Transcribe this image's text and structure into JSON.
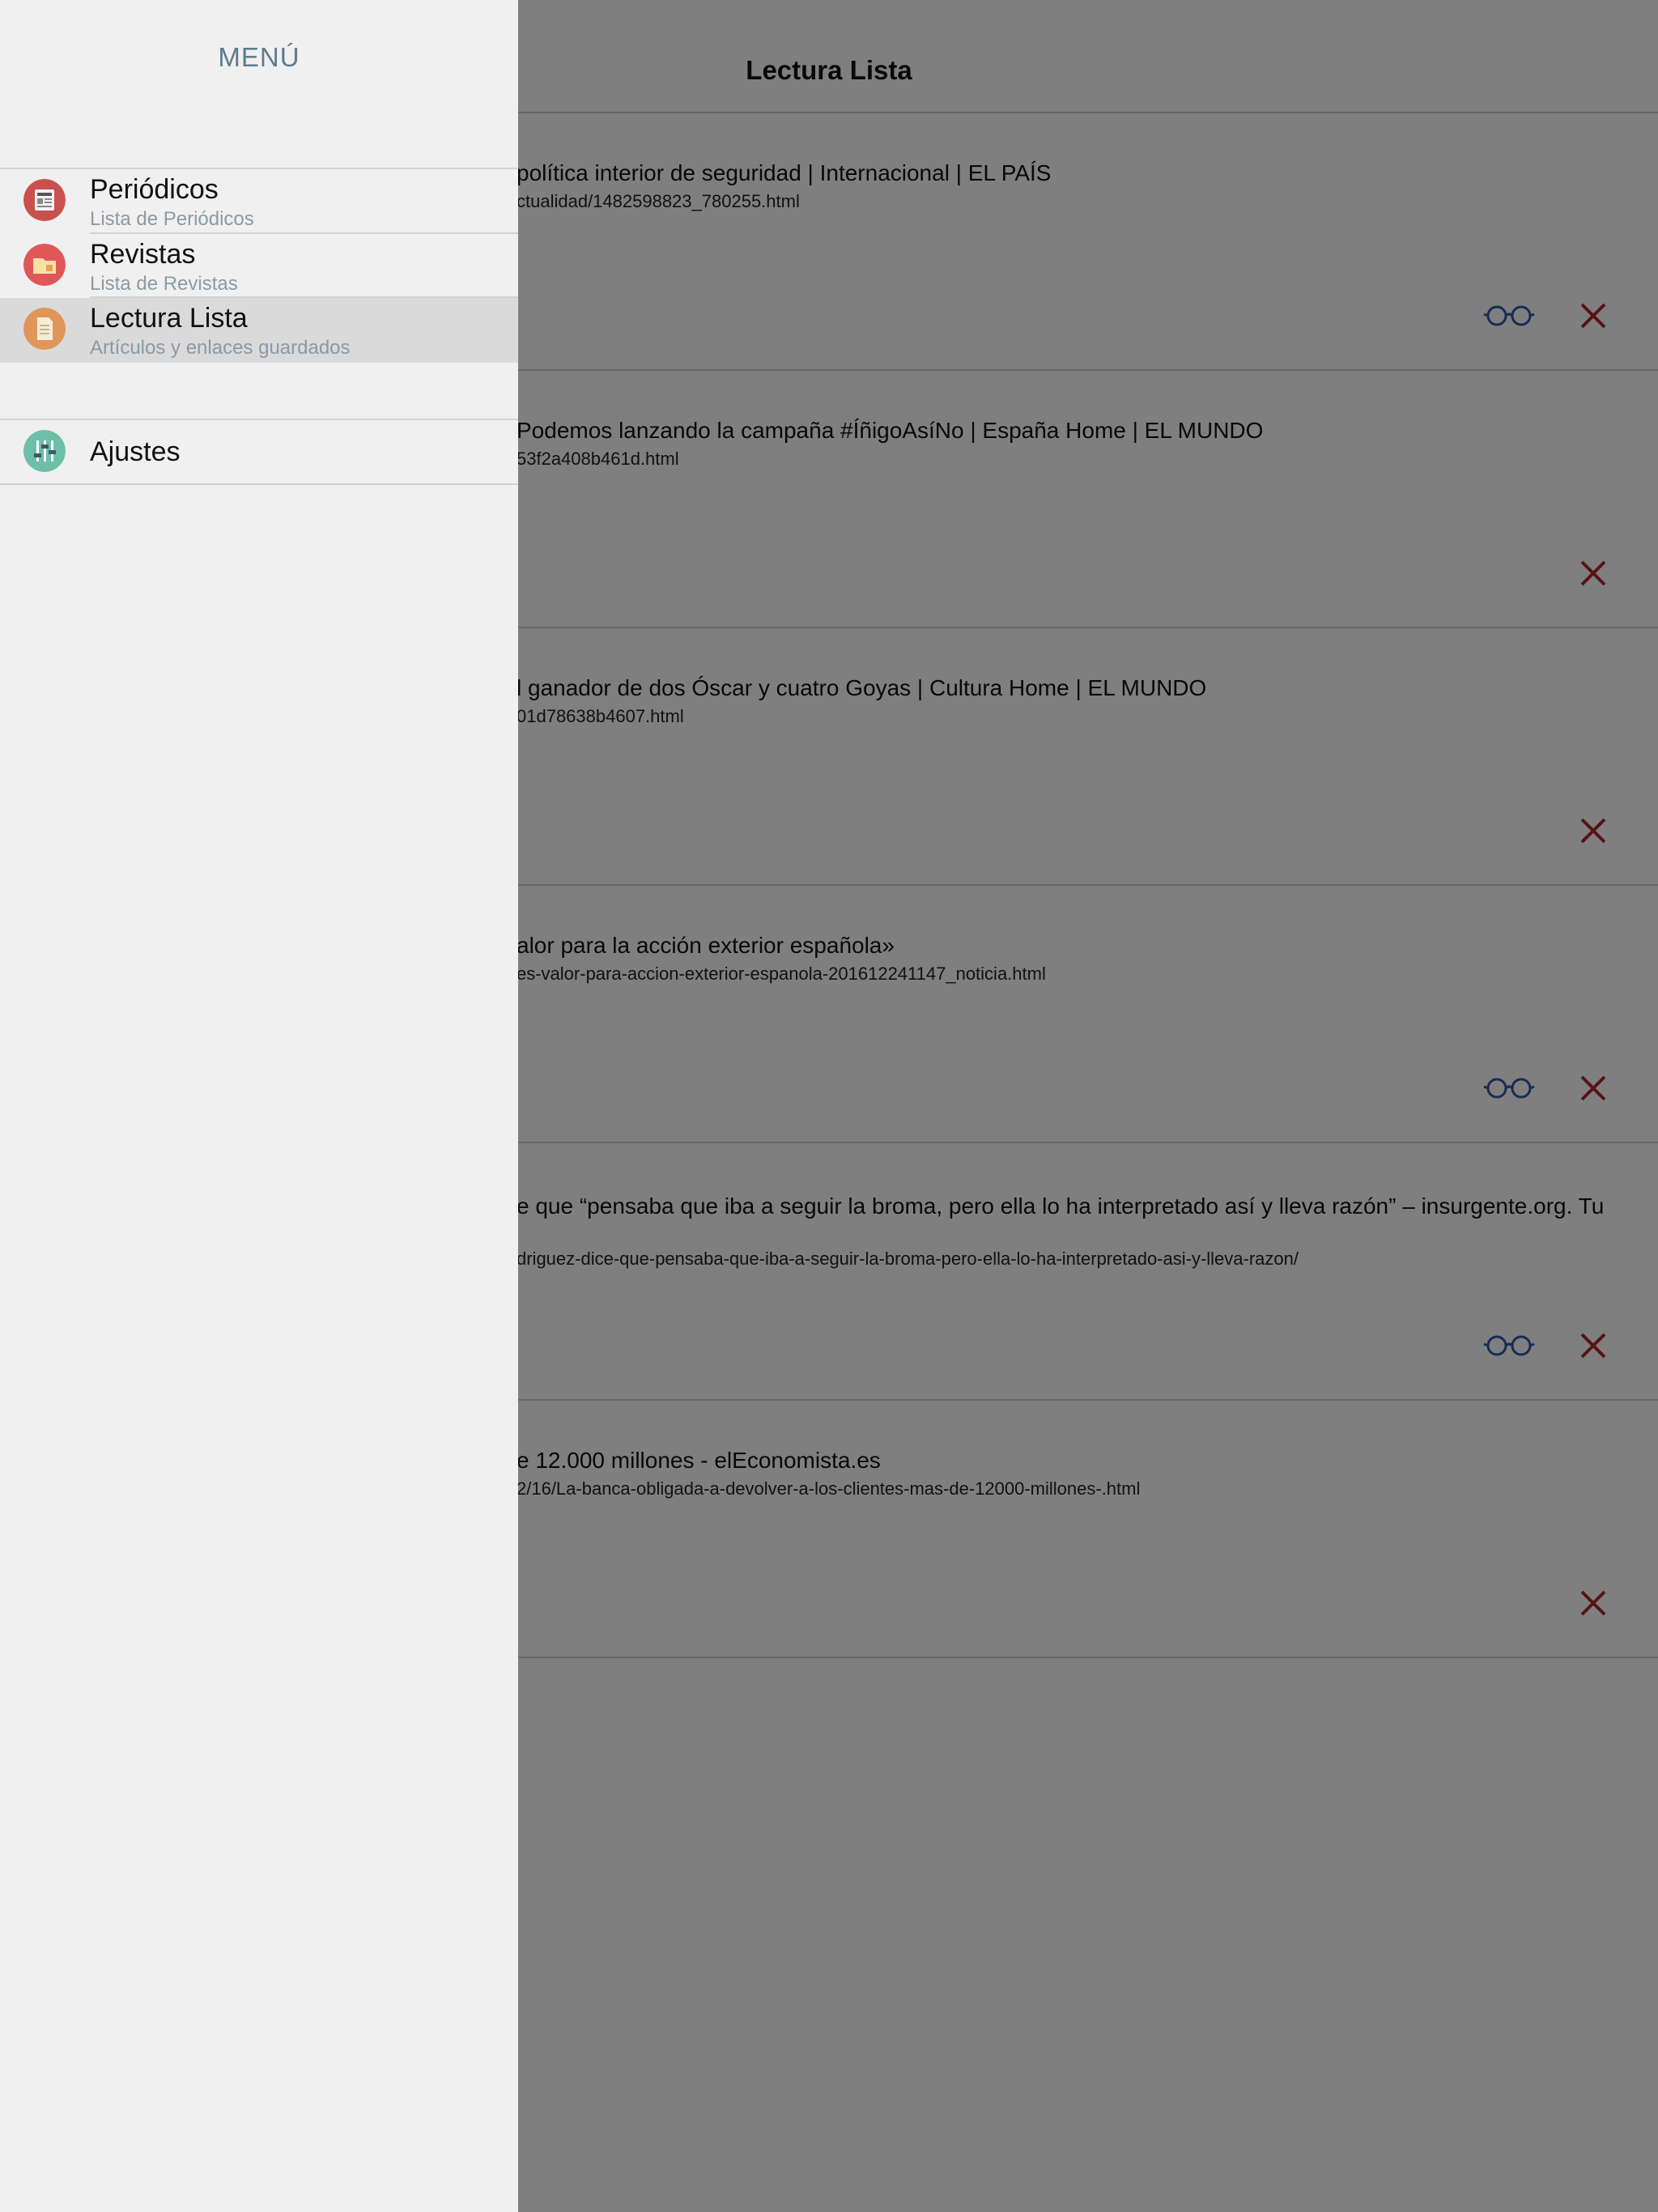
{
  "navbar": {
    "title": "Lectura Lista"
  },
  "articles": [
    {
      "title": "política interior de seguridad | Internacional | EL PAÍS",
      "url": "ctualidad/1482598823_780255.html",
      "has_read": true
    },
    {
      "title": "Podemos lanzando la campaña #ÍñigoAsíNo | España Home | EL MUNDO",
      "url": "53f2a408b461d.html",
      "has_read": false
    },
    {
      "title": "l ganador de dos Óscar y cuatro Goyas | Cultura Home | EL MUNDO",
      "url": "01d78638b4607.html",
      "has_read": false
    },
    {
      "title": "alor para la acción exterior española»",
      "url": "es-valor-para-accion-exterior-espanola-201612241147_noticia.html",
      "has_read": true
    },
    {
      "title": "e que “pensaba que iba a seguir la broma, pero ella lo ha interpretado así y lleva razón” – insurgente.org. Tu",
      "url": "driguez-dice-que-pensaba-que-iba-a-seguir-la-broma-pero-ella-lo-ha-interpretado-asi-y-lleva-razon/",
      "has_read": true
    },
    {
      "title": "e 12.000 millones - elEconomista.es",
      "url": "2/16/La-banca-obligada-a-devolver-a-los-clientes-mas-de-12000-millones-.html",
      "has_read": false
    }
  ],
  "drawer": {
    "title": "MENÚ",
    "items": [
      {
        "label": "Periódicos",
        "subtitle": "Lista de Periódicos",
        "icon": "newspaper-icon",
        "color": "#c9504f"
      },
      {
        "label": "Revistas",
        "subtitle": "Lista de Revistas",
        "icon": "magazine-icon",
        "color": "#e0575a"
      },
      {
        "label": "Lectura Lista",
        "subtitle": "Artículos y enlaces guardados",
        "icon": "document-icon",
        "color": "#e0965a",
        "selected": true
      },
      {
        "label": "Ajustes",
        "icon": "sliders-icon",
        "color": "#6dbfa9"
      }
    ]
  },
  "colors": {
    "read_icon": "#2f5aa8",
    "delete_icon": "#b0272a",
    "menu_title": "#5f7a8c"
  }
}
